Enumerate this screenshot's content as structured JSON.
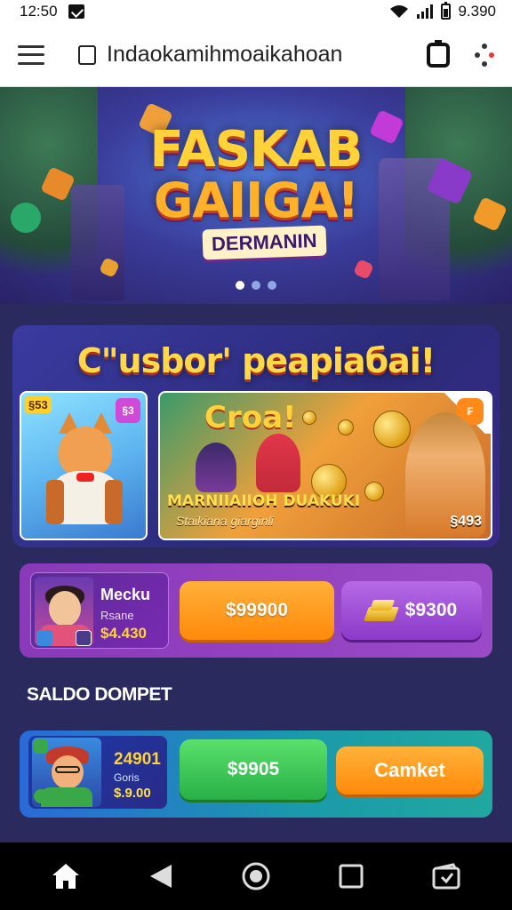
{
  "status_bar": {
    "time": "12:50",
    "battery_text": "9.390"
  },
  "app_bar": {
    "url": "Indaokamihmoaikahoan",
    "icons": [
      "menu-icon",
      "page-icon",
      "tab-icon",
      "more-icon"
    ]
  },
  "hero": {
    "title_line1": "FASKAB",
    "title_line2": "GAIIGA!",
    "subtitle": "DERMANIN",
    "slides": 3,
    "active_slide": 0
  },
  "promo": {
    "title": "C\"usbor' peapiaбai!",
    "game1": {
      "badge": "§53",
      "corner_badge": "§3"
    },
    "game2": {
      "title": "Croa!",
      "name": "MARNIIAIIOH DUAKUKI",
      "subtitle": "Staikiana giarginli",
      "amount": "§493",
      "corner_badge": "₣"
    }
  },
  "reward_row": {
    "name": "Mecku",
    "label": "Rsane",
    "amount": "$4.430",
    "button1": "$99900",
    "button2": "$9300"
  },
  "section_label": "SALDO DOMPET",
  "wallet_row": {
    "amount": "24901",
    "label": "Goris",
    "sub_amount": "$.9.00",
    "button1": "$9905",
    "button2": "Camket"
  },
  "nav": [
    "home-icon",
    "back-icon",
    "circle-home-icon",
    "recents-icon",
    "wallet-icon"
  ],
  "colors": {
    "background": "#2a2a5e",
    "accent_yellow": "#ffd23a",
    "orange": "#ff8a0a",
    "purple": "#9a4ac6",
    "green": "#28b048"
  }
}
